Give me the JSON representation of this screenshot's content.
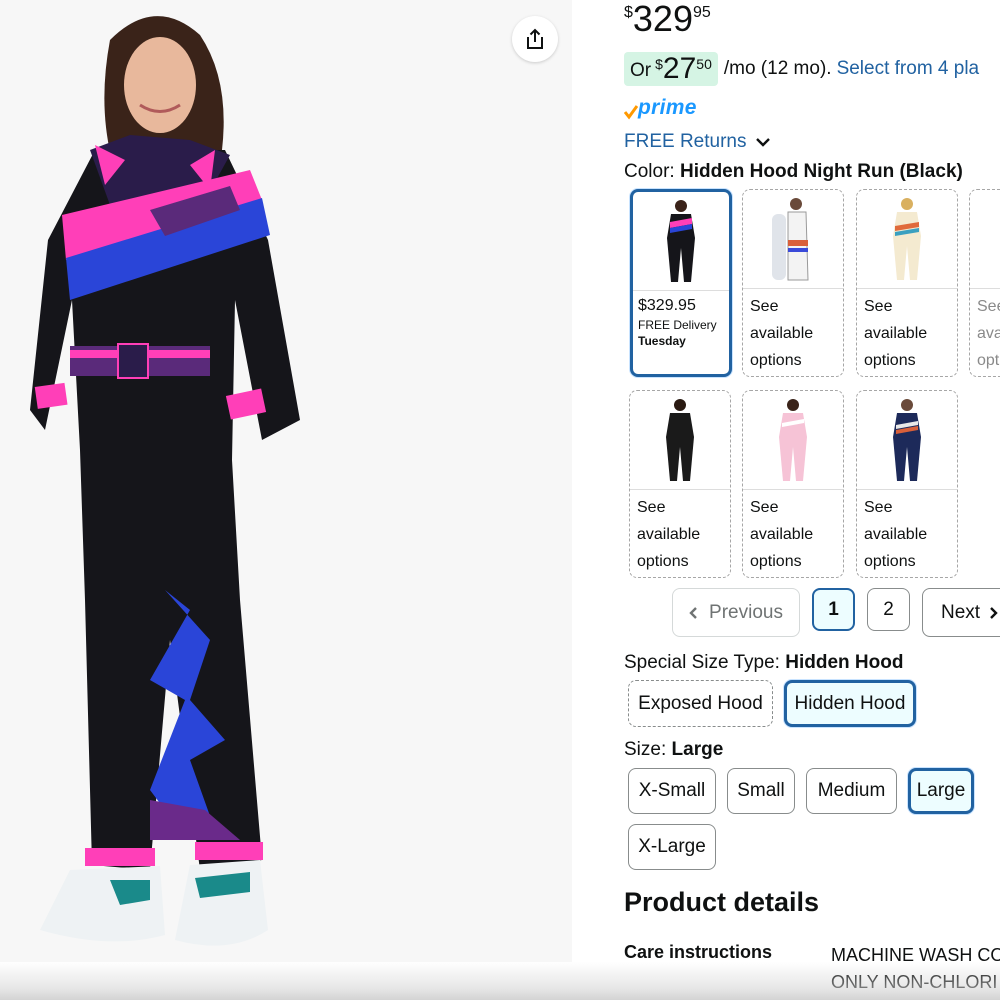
{
  "price": {
    "symbol": "$",
    "whole": "329",
    "fraction": "95"
  },
  "monthly": {
    "prefix": "Or",
    "symbol": "$",
    "whole": "27",
    "fraction": "50",
    "suffix": "/mo (12 mo).",
    "link": "Select from 4 pla"
  },
  "prime": {
    "label": "prime"
  },
  "returns": {
    "label": "FREE Returns"
  },
  "color": {
    "label": "Color:",
    "value": "Hidden Hood Night Run (Black)"
  },
  "swatches": [
    {
      "price": "$329.95",
      "delivery": "FREE Delivery",
      "day": "Tuesday"
    },
    {
      "l1": "See",
      "l2": "available",
      "l3": "options"
    },
    {
      "l1": "See",
      "l2": "available",
      "l3": "options"
    },
    {
      "l1": "See",
      "l2": "ava",
      "l3": "opt"
    },
    {
      "l1": "See",
      "l2": "available",
      "l3": "options"
    },
    {
      "l1": "See",
      "l2": "available",
      "l3": "options"
    },
    {
      "l1": "See",
      "l2": "available",
      "l3": "options"
    }
  ],
  "pagination": {
    "previous": "Previous",
    "page1": "1",
    "page2": "2",
    "next": "Next"
  },
  "special_size": {
    "label": "Special Size Type:",
    "value": "Hidden Hood",
    "options": [
      "Exposed Hood",
      "Hidden Hood"
    ]
  },
  "size": {
    "label": "Size:",
    "value": "Large",
    "options": [
      "X-Small",
      "Small",
      "Medium",
      "Large",
      "X-Large"
    ]
  },
  "product_details": {
    "title": "Product details",
    "care_label": "Care instructions",
    "care_value_line1": "MACHINE WASH CO",
    "care_value_line2": "ONLY NON-CHLORI"
  },
  "colors": {
    "link": "#2162a1",
    "selected_border": "#2162a1",
    "prime_blue": "#1a98ff",
    "prime_check": "#ff9900",
    "monthly_bg": "#d5f4e4"
  }
}
